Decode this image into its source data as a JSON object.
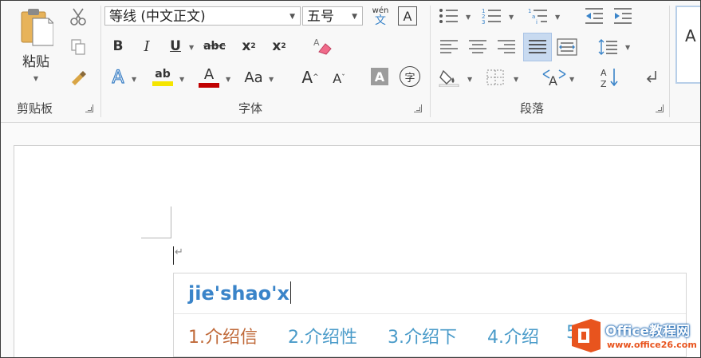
{
  "clipboard": {
    "paste_label": "粘贴",
    "group_label": "剪贴板"
  },
  "font": {
    "font_name": "等线 (中文正文)",
    "font_size": "五号",
    "pinyin_guide_top": "wén",
    "pinyin_guide_bottom": "文",
    "char_border": "A",
    "bold": "B",
    "italic": "I",
    "underline": "U",
    "strike": "abc",
    "subscript_base": "x",
    "subscript_mark": "2",
    "superscript_base": "x",
    "superscript_mark": "2",
    "text_effect": "A",
    "highlight": "ab",
    "font_color": "A",
    "change_case": "Aa",
    "grow": "A",
    "shrink": "A",
    "char_shading": "A",
    "enclose": "字",
    "group_label": "字体"
  },
  "paragraph": {
    "group_label": "段落",
    "cn_spacing": "A",
    "sort": "A↓Z"
  },
  "styles": {
    "preview": "A"
  },
  "ime": {
    "input_text": "jie'shao'x",
    "candidates": [
      {
        "label": "1.介绍信"
      },
      {
        "label": "2.介绍性"
      },
      {
        "label": "3.介绍下"
      },
      {
        "label": "4.介绍"
      },
      {
        "label": "5"
      }
    ]
  },
  "watermark": {
    "brand": "Office教程网",
    "url": "www.office26.com"
  },
  "colors": {
    "highlight_yellow": "#f5e500",
    "font_red": "#c00000",
    "ime_blue": "#3a84c9",
    "ime_selected": "#c06a3a",
    "watermark_orange": "#e8541e"
  }
}
